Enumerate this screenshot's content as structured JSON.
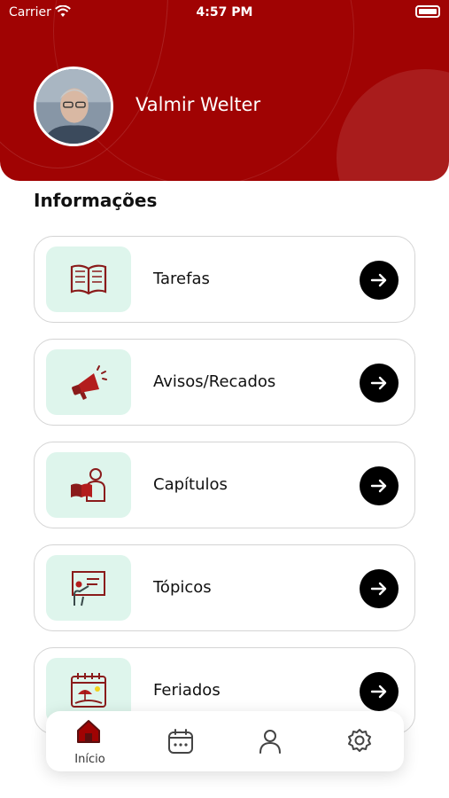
{
  "status_bar": {
    "carrier": "Carrier",
    "time": "4:57 PM"
  },
  "header": {
    "user_name": "Valmir Welter"
  },
  "section": {
    "title": "Informações"
  },
  "cards": [
    {
      "label": "Tarefas",
      "icon": "book-icon"
    },
    {
      "label": "Avisos/Recados",
      "icon": "megaphone-icon"
    },
    {
      "label": "Capítulos",
      "icon": "reader-icon"
    },
    {
      "label": "Tópicos",
      "icon": "presentation-icon"
    },
    {
      "label": "Feriados",
      "icon": "calendar-beach-icon"
    }
  ],
  "tabbar": {
    "items": [
      {
        "label": "Início",
        "icon": "home-icon",
        "active": true
      },
      {
        "label": "",
        "icon": "calendar-icon",
        "active": false
      },
      {
        "label": "",
        "icon": "profile-icon",
        "active": false
      },
      {
        "label": "",
        "icon": "settings-icon",
        "active": false
      }
    ]
  },
  "colors": {
    "brand": "#a00303",
    "icon_tile": "#def5ec",
    "arrow_button": "#000000"
  }
}
